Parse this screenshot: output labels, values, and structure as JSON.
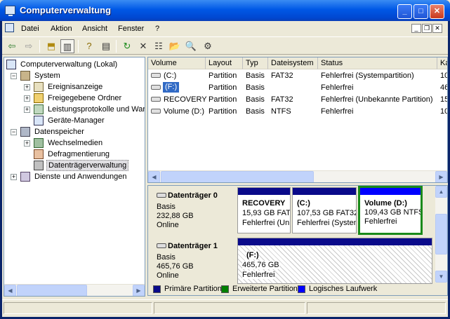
{
  "window": {
    "title": "Computerverwaltung"
  },
  "menu": {
    "file": "Datei",
    "action": "Aktion",
    "view": "Ansicht",
    "window": "Fenster",
    "help": "?"
  },
  "tree": {
    "root": "Computerverwaltung (Lokal)",
    "system": "System",
    "event_viewer": "Ereignisanzeige",
    "shared_folders": "Freigegebene Ordner",
    "perf_logs": "Leistungsprotokolle und Warnungen",
    "device_manager": "Geräte-Manager",
    "storage": "Datenspeicher",
    "removable": "Wechselmedien",
    "defrag": "Defragmentierung",
    "disk_mgmt": "Datenträgerverwaltung",
    "services": "Dienste und Anwendungen"
  },
  "volumes": {
    "columns": [
      "Volume",
      "Layout",
      "Typ",
      "Dateisystem",
      "Status",
      "Ka"
    ],
    "rows": [
      {
        "volume": "(C:)",
        "layout": "Partition",
        "type": "Basis",
        "fs": "FAT32",
        "status": "Fehlerfrei (Systempartition)",
        "cap": "10"
      },
      {
        "volume": "(F:)",
        "layout": "Partition",
        "type": "Basis",
        "fs": "",
        "status": "Fehlerfrei",
        "cap": "46"
      },
      {
        "volume": "RECOVERY",
        "layout": "Partition",
        "type": "Basis",
        "fs": "FAT32",
        "status": "Fehlerfrei (Unbekannte Partition)",
        "cap": "15"
      },
      {
        "volume": "Volume (D:)",
        "layout": "Partition",
        "type": "Basis",
        "fs": "NTFS",
        "status": "Fehlerfrei",
        "cap": "10"
      }
    ]
  },
  "disks": [
    {
      "name": "Datenträger 0",
      "type": "Basis",
      "size": "232,88 GB",
      "state": "Online",
      "partitions": [
        {
          "name": "RECOVERY",
          "size": "15,93 GB FAT32",
          "status": "Fehlerfrei (Unbekannte Partition)"
        },
        {
          "name": "(C:)",
          "size": "107,53 GB FAT32",
          "status": "Fehlerfrei (Systempartition)"
        },
        {
          "name": "Volume  (D:)",
          "size": "109,43 GB NTFS",
          "status": "Fehlerfrei"
        }
      ]
    },
    {
      "name": "Datenträger 1",
      "type": "Basis",
      "size": "465,76 GB",
      "state": "Online",
      "partitions": [
        {
          "name": "(F:)",
          "size": "465,76 GB",
          "status": "Fehlerfrei"
        }
      ]
    }
  ],
  "legend": {
    "primary": "Primäre Partition",
    "extended": "Erweiterte Partition",
    "logical": "Logisches Laufwerk",
    "colors": {
      "primary": "#0A0A8A",
      "extended": "#008000",
      "logical": "#0000FF"
    }
  }
}
